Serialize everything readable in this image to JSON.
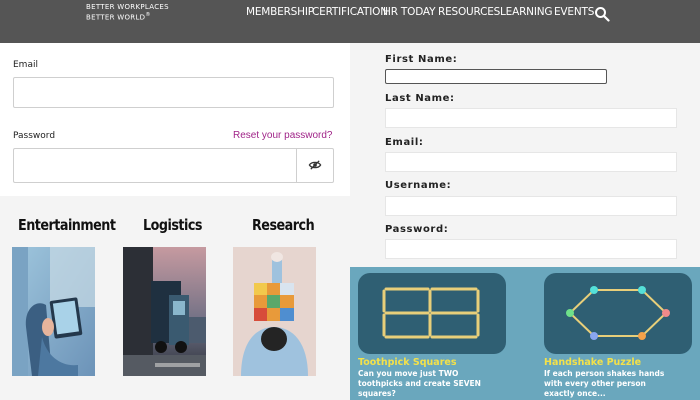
{
  "header": {
    "brand_line1": "BETTER WORKPLACES",
    "brand_line2": "BETTER WORLD",
    "brand_mark": "®",
    "nav": [
      "MEMBERSHIP",
      "CERTIFICATION",
      "HR TODAY",
      "RESOURCES",
      "LEARNING",
      "EVENTS"
    ],
    "search_icon": "search-icon"
  },
  "login": {
    "email_label": "Email",
    "email_value": "",
    "password_label": "Password",
    "password_value": "",
    "reset_link": "Reset your password?",
    "toggle_icon": "eye-slash-icon",
    "accent_color": "#a02488"
  },
  "industries": {
    "items": [
      {
        "label": "Entertainment",
        "image": "person-using-tablet-image"
      },
      {
        "label": "Logistics",
        "image": "truck-image"
      },
      {
        "label": "Research",
        "image": "person-holding-rubiks-cube-image"
      }
    ]
  },
  "signup": {
    "first_name_label": "First Name:",
    "last_name_label": "Last Name:",
    "email_label": "Email:",
    "username_label": "Username:",
    "password_label": "Password:"
  },
  "puzzles": {
    "background_color": "#6aa7bd",
    "title_color": "#f3e14a",
    "items": [
      {
        "title": "Toothpick Squares",
        "description": "Can you move just TWO toothpicks and create SEVEN squares?"
      },
      {
        "title": "Handshake Puzzle",
        "description": "If each person shakes hands with every other person exactly once..."
      }
    ]
  }
}
